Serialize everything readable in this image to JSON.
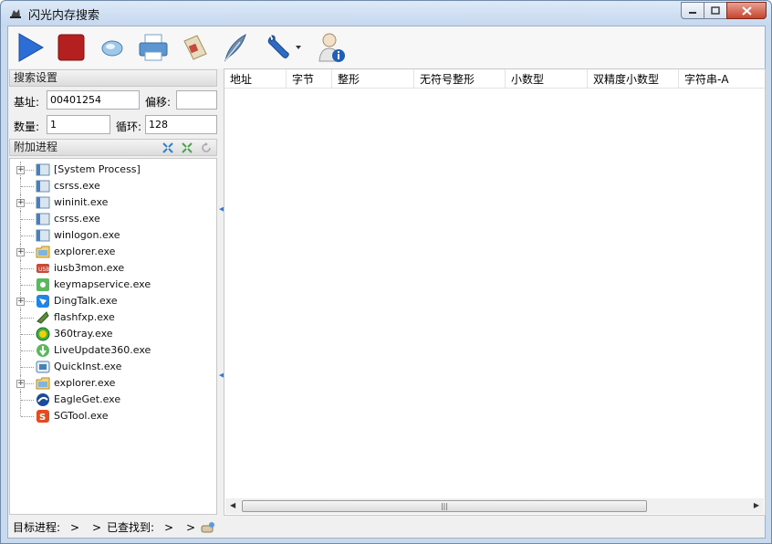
{
  "window": {
    "title": "闪光内存搜索",
    "controls": [
      "minimize-icon",
      "maximize-icon",
      "close-icon"
    ]
  },
  "toolbar": {
    "buttons": [
      {
        "name": "start",
        "icon": "play-icon"
      },
      {
        "name": "stop",
        "icon": "stop-icon"
      },
      {
        "name": "lens",
        "icon": "lens-icon"
      },
      {
        "name": "print",
        "icon": "printer-icon"
      },
      {
        "name": "save",
        "icon": "floppy-icon"
      },
      {
        "name": "feather",
        "icon": "feather-icon"
      },
      {
        "name": "tools",
        "icon": "wrench-icon"
      },
      {
        "name": "user-info",
        "icon": "user-info-icon"
      }
    ]
  },
  "search_settings": {
    "header": "搜索设置",
    "base_label": "基址:",
    "base_value": "00401254",
    "offset_label": "偏移:",
    "offset_value": "",
    "count_label": "数量:",
    "count_value": "1",
    "loop_label": "循环:",
    "loop_value": "128"
  },
  "attach": {
    "header": "附加进程",
    "processes": [
      {
        "name": "[System Process]",
        "expandable": true,
        "icon": "window-icon"
      },
      {
        "name": "csrss.exe",
        "expandable": false,
        "icon": "window-icon"
      },
      {
        "name": "wininit.exe",
        "expandable": true,
        "icon": "window-icon"
      },
      {
        "name": "csrss.exe",
        "expandable": false,
        "icon": "window-icon"
      },
      {
        "name": "winlogon.exe",
        "expandable": false,
        "icon": "window-icon"
      },
      {
        "name": "explorer.exe",
        "expandable": true,
        "icon": "folder-icon"
      },
      {
        "name": "iusb3mon.exe",
        "expandable": false,
        "icon": "usb-icon"
      },
      {
        "name": "keymapservice.exe",
        "expandable": false,
        "icon": "gear-icon"
      },
      {
        "name": "DingTalk.exe",
        "expandable": true,
        "icon": "dingtalk-icon"
      },
      {
        "name": "flashfxp.exe",
        "expandable": false,
        "icon": "flashfxp-icon"
      },
      {
        "name": "360tray.exe",
        "expandable": false,
        "icon": "360-icon"
      },
      {
        "name": "LiveUpdate360.exe",
        "expandable": false,
        "icon": "liveupdate-icon"
      },
      {
        "name": "QuickInst.exe",
        "expandable": false,
        "icon": "quickinst-icon"
      },
      {
        "name": "explorer.exe",
        "expandable": true,
        "icon": "folder-icon"
      },
      {
        "name": "EagleGet.exe",
        "expandable": false,
        "icon": "eagleget-icon"
      },
      {
        "name": "SGTool.exe",
        "expandable": false,
        "icon": "sogou-icon"
      }
    ]
  },
  "results": {
    "columns": [
      "地址",
      "字节",
      "整形",
      "无符号整形",
      "小数型",
      "双精度小数型",
      "字符串-A"
    ]
  },
  "status": {
    "target_label": "目标进程:",
    "target_value": ">",
    "sep": ">",
    "found_label": "已查找到:",
    "found_value": ">",
    "found_sep": ">"
  }
}
